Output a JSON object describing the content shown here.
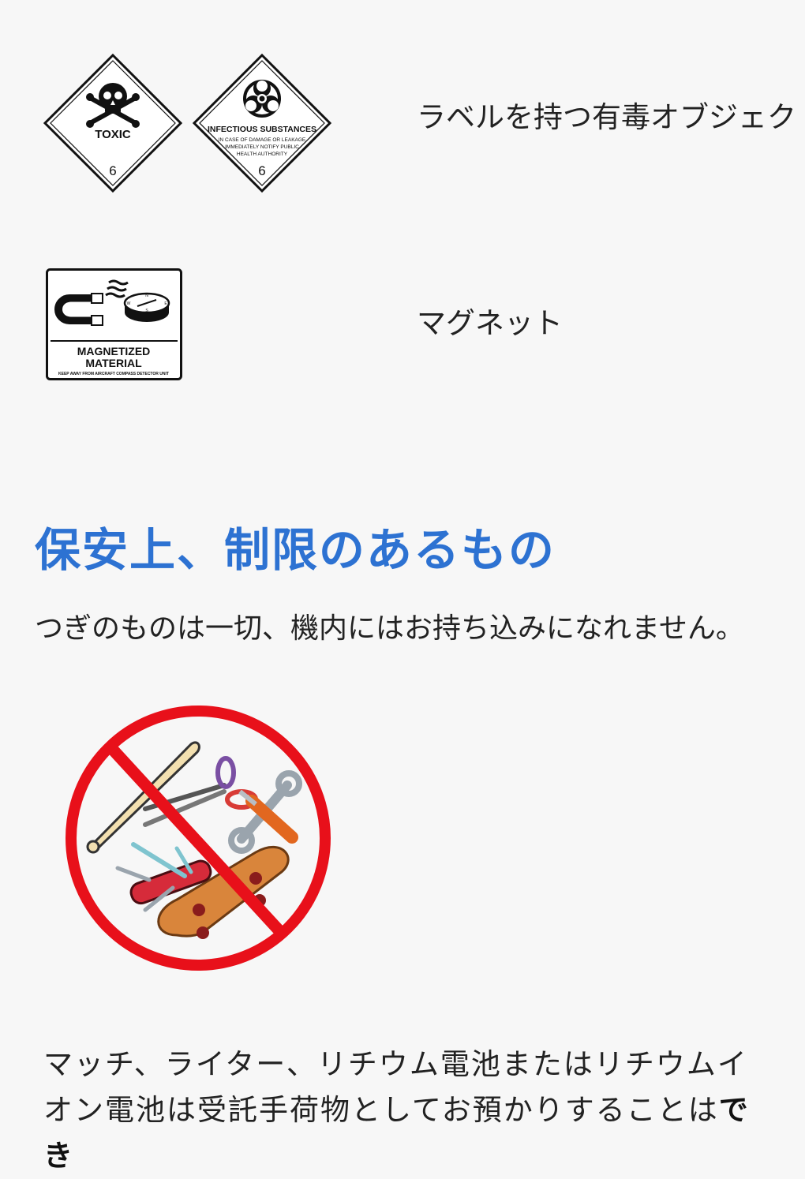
{
  "labels_section": {
    "row1": {
      "text": "ラベルを持つ有毒オブジェクト",
      "toxic_label": {
        "word": "TOXIC",
        "class_number": "6"
      },
      "infectious_label": {
        "title": "INFECTIOUS SUBSTANCES",
        "line1": "IN CASE OF DAMAGE OR LEAKAGE",
        "line2": "IMMEDIATELY NOTIFY PUBLIC",
        "line3": "HEALTH AUTHORITY",
        "class_number": "6"
      }
    },
    "row2": {
      "text": "マグネット",
      "magnet_label": {
        "line1": "MAGNETIZED",
        "line2": "MATERIAL",
        "small": "KEEP AWAY FROM AIRCRAFT COMPASS DETECTOR UNIT",
        "compass_n": "N",
        "compass_s": "S",
        "compass_e": "E",
        "compass_w": "W"
      }
    }
  },
  "security_section": {
    "heading": "保安上、制限のあるもの",
    "intro": "つぎのものは一切、機内にはお持ち込みになれません。"
  },
  "bottom_paragraph": {
    "text": "マッチ、ライター、リチウム電池またはリチウムイオン電池は受託手荷物としてお預かりすることは",
    "bold_text": "でき"
  },
  "colors": {
    "heading": "#2d72d2",
    "prohibited_red": "#e8101a",
    "background": "#f7f7f7"
  }
}
